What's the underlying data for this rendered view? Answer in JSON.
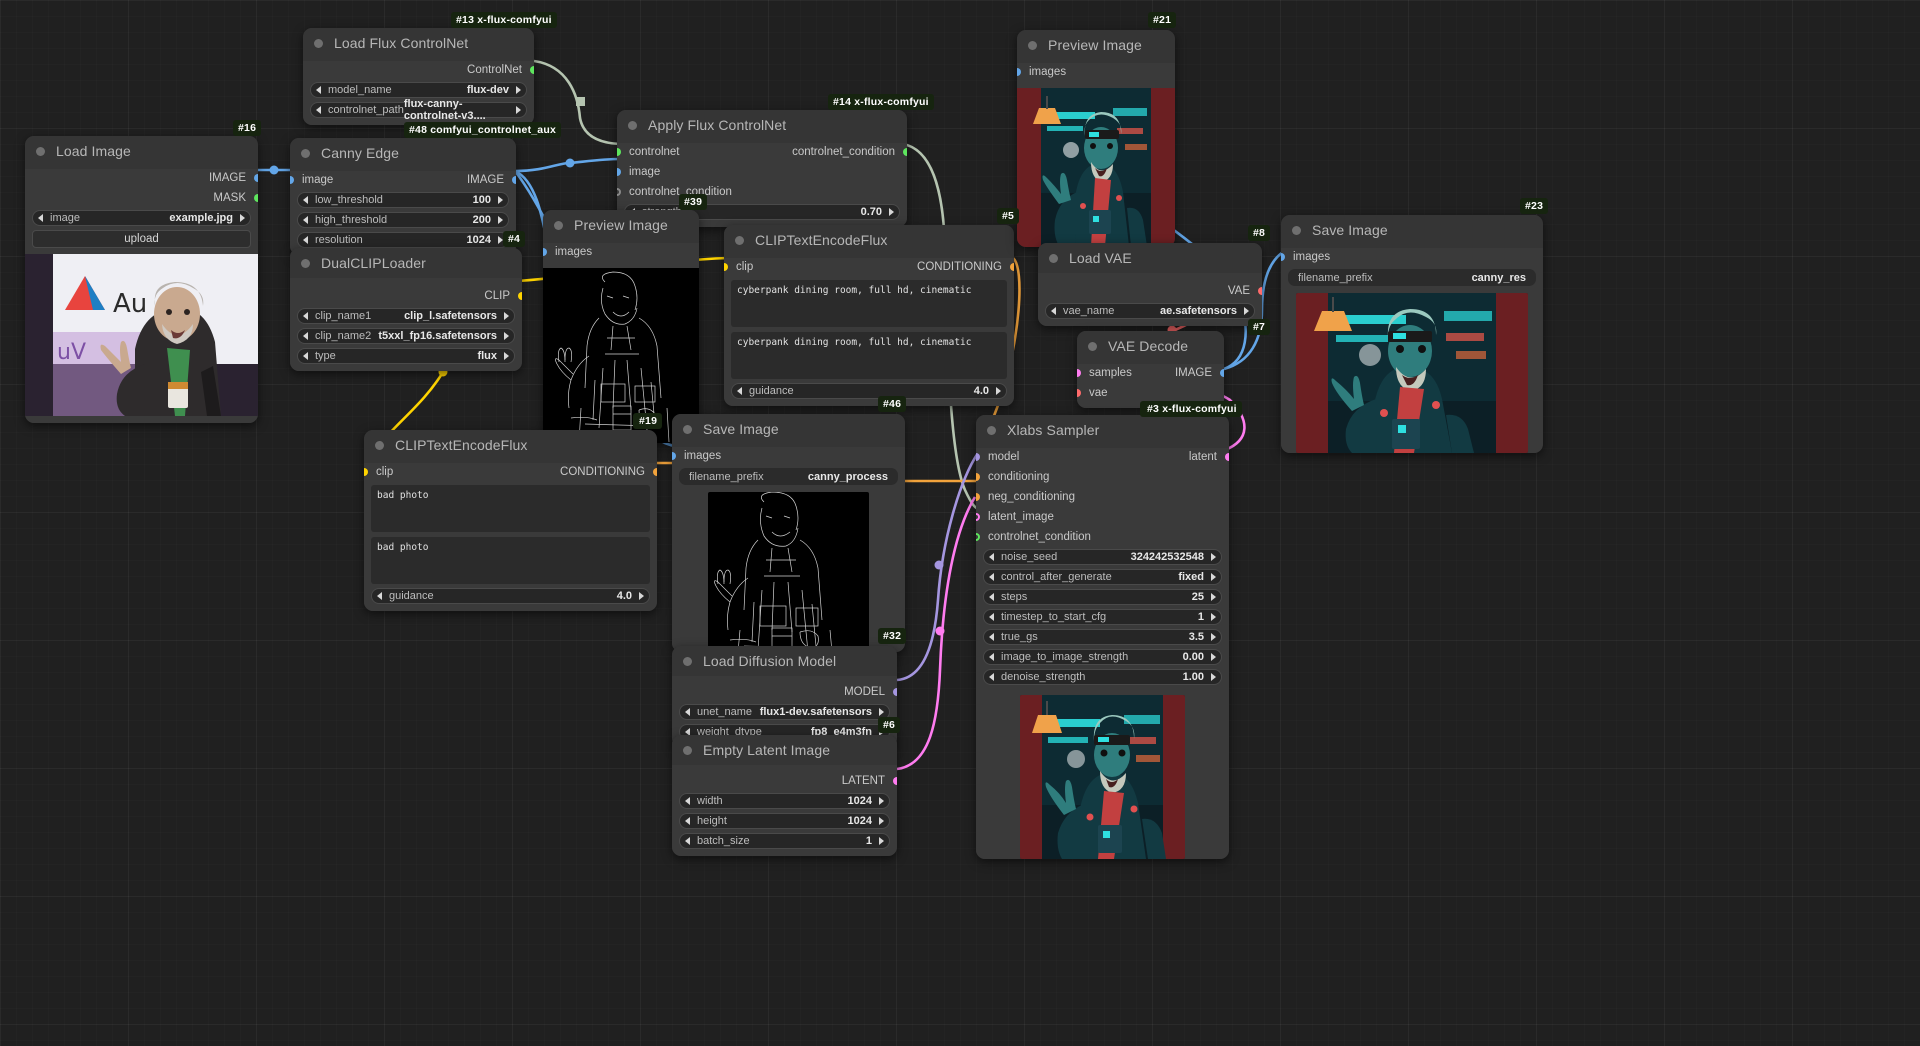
{
  "app": {
    "name": "ComfyUI Node Graph",
    "background": "#202020"
  },
  "colors": {
    "image_link": "#63a6e8",
    "clip_link": "#ffd400",
    "controlnet_link": "#b5c4b0",
    "conditioning_link": "#f2a33c",
    "vae_link": "#ff6b6b",
    "latent_link": "#ff7cf0",
    "model_link": "#a596e0",
    "node_body": "#3a3a3a",
    "node_header": "#353535",
    "badge_bg": "#16240f"
  },
  "nodes": [
    {
      "id": "load-flux-controlnet",
      "badge": "#13 x-flux-comfyui",
      "title": "Load Flux ControlNet",
      "outputs": [
        {
          "label": "ControlNet",
          "color": "#5ee65e"
        }
      ],
      "widgets": [
        {
          "name": "model_name",
          "value": "flux-dev"
        },
        {
          "name": "controlnet_path",
          "value": "flux-canny-controlnet-v3...."
        }
      ]
    },
    {
      "id": "load-image",
      "badge": "#16",
      "title": "Load Image",
      "outputs": [
        {
          "label": "IMAGE",
          "color": "#63a6e8"
        },
        {
          "label": "MASK",
          "color": "#5ee65e"
        }
      ],
      "widgets": [
        {
          "name": "image",
          "value": "example.jpg"
        }
      ],
      "button": "upload",
      "preview": "photo-speaker"
    },
    {
      "id": "canny-edge",
      "badge": "#48 comfyui_controlnet_aux",
      "title": "Canny Edge",
      "inputs": [
        {
          "label": "image",
          "color": "#63a6e8"
        }
      ],
      "outputs": [
        {
          "label": "IMAGE",
          "color": "#63a6e8"
        }
      ],
      "widgets": [
        {
          "name": "low_threshold",
          "value": "100"
        },
        {
          "name": "high_threshold",
          "value": "200"
        },
        {
          "name": "resolution",
          "value": "1024"
        }
      ]
    },
    {
      "id": "dual-clip-loader",
      "badge": "#4",
      "title": "DualCLIPLoader",
      "outputs": [
        {
          "label": "CLIP",
          "color": "#ffd400"
        }
      ],
      "widgets": [
        {
          "name": "clip_name1",
          "value": "clip_l.safetensors"
        },
        {
          "name": "clip_name2",
          "value": "t5xxl_fp16.safetensors"
        },
        {
          "name": "type",
          "value": "flux"
        }
      ]
    },
    {
      "id": "apply-flux-controlnet",
      "badge": "#14 x-flux-comfyui",
      "badge2": "#39",
      "title": "Apply Flux ControlNet",
      "inputs": [
        {
          "label": "controlnet",
          "color": "#5ee65e"
        },
        {
          "label": "image",
          "color": "#63a6e8"
        },
        {
          "label": "controlnet_condition",
          "color": "#8a8a8a",
          "hollow": true
        }
      ],
      "outputs": [
        {
          "label": "controlnet_condition",
          "color": "#5ee65e"
        }
      ],
      "widgets": [
        {
          "name": "strength",
          "value": "0.70"
        }
      ]
    },
    {
      "id": "preview-image-canny",
      "badge": "#19",
      "title": "Preview Image",
      "inputs": [
        {
          "label": "images",
          "color": "#63a6e8"
        }
      ],
      "preview": "canny-edges"
    },
    {
      "id": "clip-text-encode-positive",
      "badge": "#5",
      "title": "CLIPTextEncodeFlux",
      "inputs": [
        {
          "label": "clip",
          "color": "#ffd400"
        }
      ],
      "outputs": [
        {
          "label": "CONDITIONING",
          "color": "#f2a33c"
        }
      ],
      "text1": "cyberpank dining room, full hd, cinematic",
      "text2": "cyberpank dining room, full hd, cinematic",
      "widgets": [
        {
          "name": "guidance",
          "value": "4.0"
        }
      ]
    },
    {
      "id": "clip-text-encode-negative",
      "badge": "#19",
      "title": "CLIPTextEncodeFlux",
      "inputs": [
        {
          "label": "clip",
          "color": "#ffd400"
        }
      ],
      "outputs": [
        {
          "label": "CONDITIONING",
          "color": "#f2a33c"
        }
      ],
      "text1": "bad photo",
      "text2": "bad photo",
      "widgets": [
        {
          "name": "guidance",
          "value": "4.0"
        }
      ]
    },
    {
      "id": "preview-image-result",
      "badge": "#21",
      "title": "Preview Image",
      "inputs": [
        {
          "label": "images",
          "color": "#63a6e8"
        }
      ],
      "preview": "cyberpunk-portrait"
    },
    {
      "id": "load-vae",
      "badge": "#8",
      "title": "Load VAE",
      "outputs": [
        {
          "label": "VAE",
          "color": "#ff6b6b"
        }
      ],
      "widgets": [
        {
          "name": "vae_name",
          "value": "ae.safetensors"
        }
      ]
    },
    {
      "id": "vae-decode",
      "badge": "#7",
      "badge2": "#3 x-flux-comfyui",
      "title": "VAE Decode",
      "inputs": [
        {
          "label": "samples",
          "color": "#ff7cf0"
        },
        {
          "label": "vae",
          "color": "#ff6b6b"
        }
      ],
      "outputs": [
        {
          "label": "IMAGE",
          "color": "#63a6e8"
        }
      ]
    },
    {
      "id": "save-image-canny-res",
      "badge": "#23",
      "title": "Save Image",
      "inputs": [
        {
          "label": "images",
          "color": "#63a6e8"
        }
      ],
      "widgets": [
        {
          "name": "filename_prefix",
          "value": "canny_res",
          "flat": true
        }
      ],
      "preview": "cyberpunk-portrait"
    },
    {
      "id": "save-image-canny-process",
      "badge": "#46",
      "title": "Save Image",
      "inputs": [
        {
          "label": "images",
          "color": "#63a6e8"
        }
      ],
      "widgets": [
        {
          "name": "filename_prefix",
          "value": "canny_process",
          "flat": true
        }
      ],
      "preview": "canny-edges"
    },
    {
      "id": "load-diffusion-model",
      "badge": "#32",
      "title": "Load Diffusion Model",
      "outputs": [
        {
          "label": "MODEL",
          "color": "#a596e0"
        }
      ],
      "widgets": [
        {
          "name": "unet_name",
          "value": "flux1-dev.safetensors"
        },
        {
          "name": "weight_dtype",
          "value": "fp8_e4m3fn"
        }
      ]
    },
    {
      "id": "empty-latent-image",
      "badge": "#6",
      "title": "Empty Latent Image",
      "outputs": [
        {
          "label": "LATENT",
          "color": "#ff7cf0"
        }
      ],
      "widgets": [
        {
          "name": "width",
          "value": "1024"
        },
        {
          "name": "height",
          "value": "1024"
        },
        {
          "name": "batch_size",
          "value": "1"
        }
      ]
    },
    {
      "id": "xlabs-sampler",
      "badge": "#3 x-flux-comfyui",
      "title": "Xlabs Sampler",
      "inputs": [
        {
          "label": "model",
          "color": "#a596e0"
        },
        {
          "label": "conditioning",
          "color": "#f2a33c"
        },
        {
          "label": "neg_conditioning",
          "color": "#f2a33c"
        },
        {
          "label": "latent_image",
          "color": "#ff7cf0",
          "hollow": true
        },
        {
          "label": "controlnet_condition",
          "color": "#5ee65e",
          "hollow": true
        }
      ],
      "outputs": [
        {
          "label": "latent",
          "color": "#ff7cf0"
        }
      ],
      "widgets": [
        {
          "name": "noise_seed",
          "value": "324242532548"
        },
        {
          "name": "control_after_generate",
          "value": "fixed"
        },
        {
          "name": "steps",
          "value": "25"
        },
        {
          "name": "timestep_to_start_cfg",
          "value": "1"
        },
        {
          "name": "true_gs",
          "value": "3.5"
        },
        {
          "name": "image_to_image_strength",
          "value": "0.00"
        },
        {
          "name": "denoise_strength",
          "value": "1.00"
        }
      ],
      "preview": "cyberpunk-portrait"
    }
  ]
}
